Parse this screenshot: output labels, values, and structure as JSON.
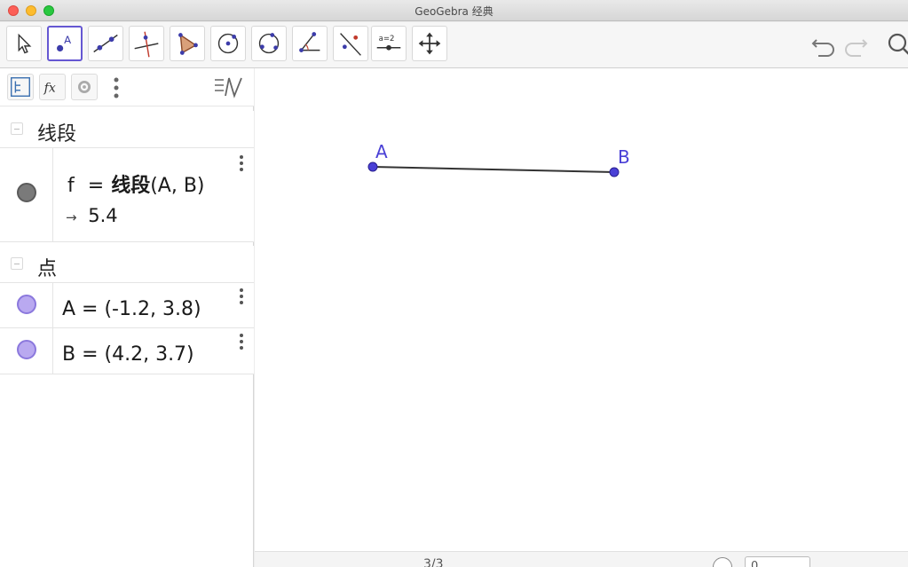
{
  "window": {
    "title": "GeoGebra 经典"
  },
  "toolbar": {
    "tools": [
      {
        "name": "move-tool",
        "icon": "arrow-pointer-icon"
      },
      {
        "name": "point-tool",
        "icon": "point-A-icon",
        "selected": true
      },
      {
        "name": "line-tool",
        "icon": "line-through-points-icon"
      },
      {
        "name": "perpendicular-line-tool",
        "icon": "perpendicular-line-icon"
      },
      {
        "name": "polygon-tool",
        "icon": "polygon-icon"
      },
      {
        "name": "circle-center-point-tool",
        "icon": "circle-center-icon"
      },
      {
        "name": "circle-three-points-tool",
        "icon": "circle-three-points-icon"
      },
      {
        "name": "angle-tool",
        "icon": "angle-icon"
      },
      {
        "name": "reflect-tool",
        "icon": "reflect-about-line-icon"
      },
      {
        "name": "slider-tool",
        "icon": "slider-icon",
        "label": "a=2"
      },
      {
        "name": "move-graphics-view-tool",
        "icon": "move-cross-icon"
      }
    ],
    "undo": "undo-icon",
    "redo": "redo-icon",
    "search": "search-icon"
  },
  "algebra": {
    "groups": [
      {
        "label": "线段",
        "items": [
          {
            "lhs": "f",
            "eq": "=",
            "rhs_bold": "线段",
            "rhs_args": "(A, B)",
            "result_arrow": "→",
            "result": "5.4",
            "color": "#7a7a7a"
          }
        ]
      },
      {
        "label": "点",
        "items": [
          {
            "expr": "A = (-1.2, 3.8)",
            "color": "#b9a9f0"
          },
          {
            "expr": "B = (4.2, 3.7)",
            "color": "#b9a9f0"
          }
        ]
      }
    ]
  },
  "graphics": {
    "points": [
      {
        "label": "A",
        "coords": [
          -1.2,
          3.8
        ]
      },
      {
        "label": "B",
        "coords": [
          4.2,
          3.7
        ]
      }
    ],
    "segment": {
      "name": "f",
      "from": "A",
      "to": "B",
      "color": "#333333"
    },
    "point_color": "#4a40d6",
    "bottom_text": "3/3",
    "bottom_input": "0"
  }
}
